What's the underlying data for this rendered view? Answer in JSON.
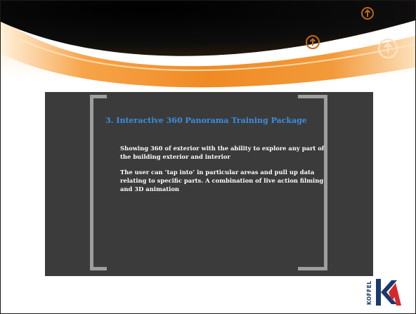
{
  "slide": {
    "title": "3. Interactive 360 Panorama Training Package",
    "paragraphs": [
      "Showing 360 of exterior with the ability to explore any part of the building exterior and interior",
      "The user can ‘tap into’ in particular areas and pull up data relating to specific parts.  A combination of live action filming  and  3D animation"
    ]
  },
  "logo": {
    "word": "KOFFEL"
  },
  "colors": {
    "accent_orange": "#f08a24",
    "title_blue": "#3a8fe0",
    "panel": "#3b3b3b",
    "bracket": "#9e9e9e",
    "logo_navy": "#1b3a6b",
    "logo_red": "#d62828"
  },
  "icons": [
    "arrow-up-circle-icon",
    "arrow-up-circle-icon",
    "arrow-up-circle-icon"
  ]
}
